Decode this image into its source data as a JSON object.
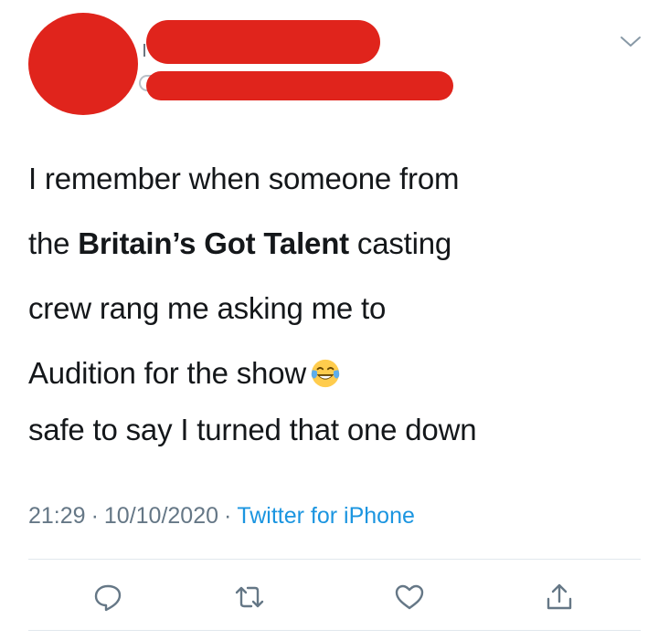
{
  "tweet": {
    "body_lines": [
      {
        "before": "I remember when someone from",
        "bold": "",
        "after": ""
      },
      {
        "before": "the ",
        "bold": "Britain’s Got Talent",
        "after": " casting"
      },
      {
        "before": "crew rang me asking me to",
        "bold": "",
        "after": ""
      },
      {
        "before": "Audition for the show",
        "bold": "",
        "after": ""
      }
    ],
    "second_paragraph": "safe to say I turned that one down",
    "emoji": "face-with-tears-of-joy",
    "meta": {
      "time": "21:29",
      "date": "10/10/2020",
      "separator": "·",
      "source": "Twitter for iPhone"
    }
  },
  "header": {
    "chevron_icon": "chevron-down-icon"
  },
  "actions": [
    {
      "name": "reply-icon"
    },
    {
      "name": "retweet-icon"
    },
    {
      "name": "like-icon"
    },
    {
      "name": "share-icon"
    }
  ],
  "colors": {
    "redaction": "#e0241c",
    "text": "#14171a",
    "meta": "#657786",
    "link": "#1b95e0",
    "icon": "#657786",
    "divider": "#e1e8ed"
  }
}
